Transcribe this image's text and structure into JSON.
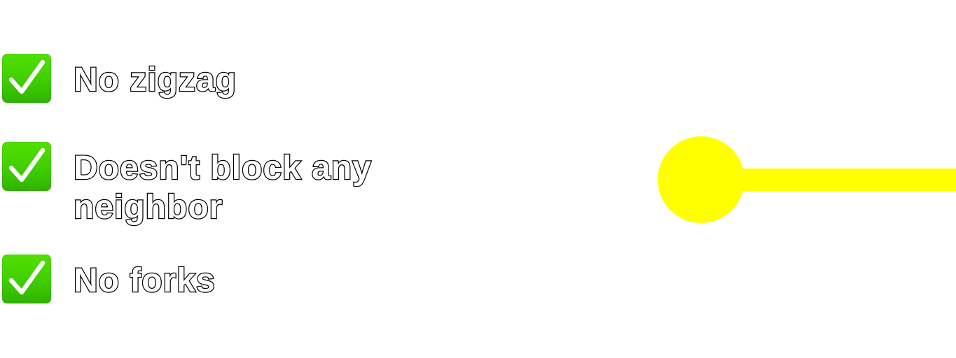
{
  "checklist": {
    "items": [
      {
        "label": "No zigzag",
        "checked": true,
        "icon": "check-mark-icon"
      },
      {
        "label": "Doesn't block any neighbor",
        "checked": true,
        "icon": "check-mark-icon"
      },
      {
        "label": "No forks",
        "checked": true,
        "icon": "check-mark-icon"
      }
    ]
  },
  "colors": {
    "check_green": "#3fce00",
    "path_yellow": "#ffff00",
    "text_fill": "#ffffff",
    "text_outline": "#000000",
    "background": "#ffffff"
  }
}
